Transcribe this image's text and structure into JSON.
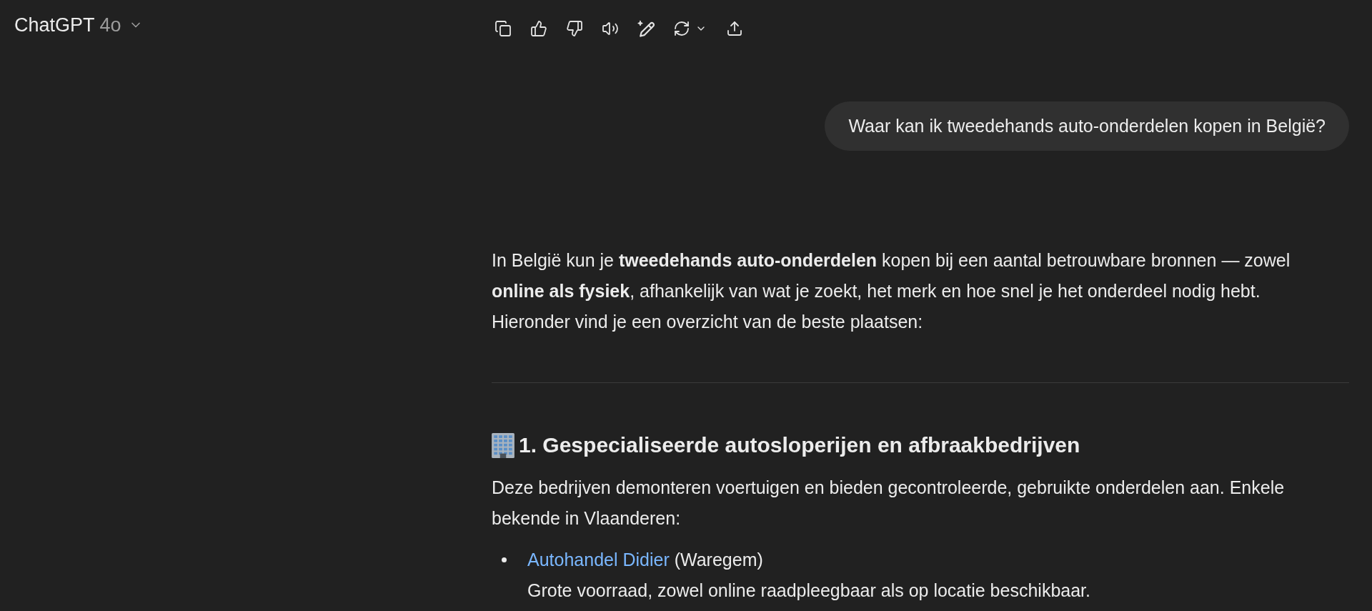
{
  "header": {
    "title": "ChatGPT",
    "model": "4o"
  },
  "user_message": {
    "text": "Waar kan ik tweedehands auto-onderdelen kopen in België?"
  },
  "assistant_message": {
    "blocks": [
      {
        "kind": "paragraph",
        "text": "In België kun je **tweedehands auto-onderdelen** kopen bij een aantal betrouwbare bronnen — zowel **online als fysiek**, afhankelijk van wat je zoekt, het merk en hoe snel je het onderdeel nodig hebt. Hieronder vind je een overzicht van de beste plaatsen:"
      },
      {
        "kind": "divider"
      },
      {
        "kind": "heading",
        "text": "1. Gespecialiseerde autosloperijen en afbraakbedrijven"
      },
      {
        "kind": "paragraph",
        "text": "Deze bedrijven demonteren voertuigen en bieden gecontroleerde, gebruikte onderdelen aan. Enkele bekende in Vlaanderen:"
      },
      {
        "kind": "list",
        "items": [
          {
            "link": "Autohandel Didier",
            "location": "(Waregem)",
            "description": "Grote voorraad, zowel online raadpleegbaar als op locatie beschikbaar."
          }
        ]
      }
    ]
  }
}
